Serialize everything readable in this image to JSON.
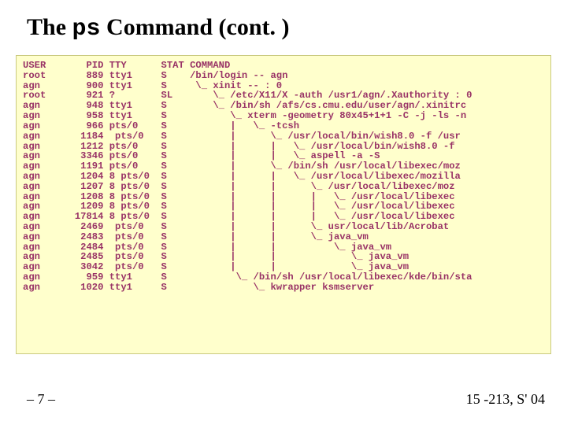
{
  "title_pre": "The ",
  "title_mono": "ps",
  "title_post": " Command (cont. )",
  "pagenum": "– 7 –",
  "course": "15 -213, S' 04",
  "ps_output": "USER       PID TTY      STAT COMMAND\nroot       889 tty1     S    /bin/login -- agn\nagn        900 tty1     S     \\_ xinit -- : 0\nroot       921 ?        SL       \\_ /etc/X11/X -auth /usr1/agn/.Xauthority : 0\nagn        948 tty1     S        \\_ /bin/sh /afs/cs.cmu.edu/user/agn/.xinitrc\nagn        958 tty1     S           \\_ xterm -geometry 80x45+1+1 -C -j -ls -n\nagn        966 pts/0    S           |   \\_ -tcsh\nagn       1184  pts/0   S           |      \\_ /usr/local/bin/wish8.0 -f /usr\nagn       1212 pts/0    S           |      |   \\_ /usr/local/bin/wish8.0 -f\nagn       3346 pts/0    S           |      |   \\_ aspell -a -S\nagn       1191 pts/0    S           |      \\_ /bin/sh /usr/local/libexec/moz\nagn       1204 8 pts/0  S           |      |   \\_ /usr/local/libexec/mozilla\nagn       1207 8 pts/0  S           |      |      \\_ /usr/local/libexec/moz\nagn       1208 8 pts/0  S           |      |      |   \\_ /usr/local/libexec\nagn       1209 8 pts/0  S           |      |      |   \\_ /usr/local/libexec\nagn      17814 8 pts/0  S           |      |      |   \\_ /usr/local/libexec\nagn       2469  pts/0   S           |      |      \\_ usr/local/lib/Acrobat\nagn       2483  pts/0   S           |      |      \\_ java_vm\nagn       2484  pts/0   S           |      |          \\_ java_vm\nagn       2485  pts/0   S           |      |             \\_ java_vm\nagn       3042  pts/0   S           |      |             \\_ java_vm\nagn        959 tty1     S            \\_ /bin/sh /usr/local/libexec/kde/bin/sta\nagn       1020 tty1     S               \\_ kwrapper ksmserver"
}
